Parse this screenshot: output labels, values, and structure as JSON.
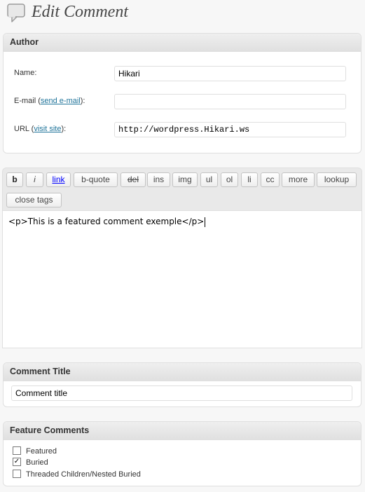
{
  "page": {
    "title": "Edit Comment",
    "icon": "comment-icon"
  },
  "author": {
    "heading": "Author",
    "name_label": "Name:",
    "name_value": "Hikari",
    "email_label_prefix": "E-mail (",
    "email_link": "send e-mail",
    "email_label_suffix": "):",
    "email_value": "",
    "url_label_prefix": "URL (",
    "url_link": "visit site",
    "url_label_suffix": "):",
    "url_value": "http://wordpress.Hikari.ws"
  },
  "editor": {
    "buttons": [
      "b",
      "i",
      "link",
      "b-quote",
      "del",
      "ins",
      "img",
      "ul",
      "ol",
      "li",
      "cc",
      "more",
      "lookup",
      "close tags"
    ],
    "content": "<p>This is a featured comment exemple</p>"
  },
  "comment_title": {
    "heading": "Comment Title",
    "value": "Comment title"
  },
  "feature_comments": {
    "heading": "Feature Comments",
    "options": [
      {
        "label": "Featured",
        "checked": false
      },
      {
        "label": "Buried",
        "checked": true
      },
      {
        "label": "Threaded Children/Nested Buried",
        "checked": false
      }
    ]
  }
}
